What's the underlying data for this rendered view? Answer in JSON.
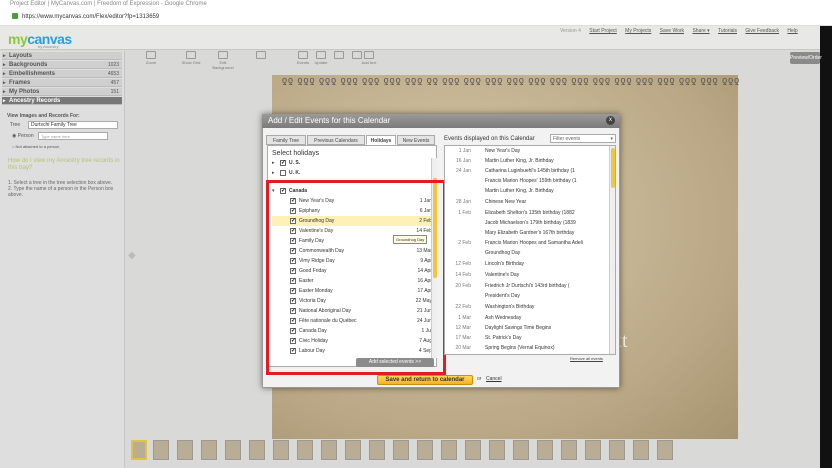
{
  "browser": {
    "title": "Project Editor | MyCanvas.com | Freedom of Expression - Google Chrome",
    "url": "https://www.mycanvas.com/Flex/editor?fp=1313659"
  },
  "app": {
    "logo_my": "my",
    "logo_canvas": "canvas",
    "logo_sub": "by Ancestry",
    "version": "Version 4",
    "links": [
      "Start Project",
      "My Projects",
      "Save Work",
      "Share ▾",
      "Tutorials",
      "Give Feedback",
      "Help"
    ],
    "preview": "Preview/Order"
  },
  "toolbar": [
    "Zoom",
    "Show Grid",
    "Edit Background",
    "",
    "Events",
    "Update",
    "",
    "",
    "Add text"
  ],
  "left_panel": {
    "sections": [
      {
        "label": "Layouts",
        "count": ""
      },
      {
        "label": "Backgrounds",
        "count": "1023"
      },
      {
        "label": "Embellishments",
        "count": "4653"
      },
      {
        "label": "Frames",
        "count": "457"
      },
      {
        "label": "My Photos",
        "count": "151"
      },
      {
        "label": "Ancestry Records",
        "count": ""
      }
    ],
    "view_label": "View Images and Records For:",
    "tree_label": "Tree",
    "tree_value": "Durtschi Family Tree",
    "person_label": "Person",
    "person_placeholder": "Type name here",
    "not_attached": "Not attached to a person",
    "help_link": "How do I view my Ancestry tree records in this tray?",
    "steps": "1. Select a tree in the tree selection box above.\n2. Type the name of a person in the Person box above."
  },
  "canvas": {
    "text": "xt"
  },
  "modal": {
    "title": "Add / Edit Events for this Calendar",
    "close": "x",
    "tabs": [
      "Family Tree",
      "Previous Calendars",
      "Holidays",
      "New Events"
    ],
    "select_label": "Select holidays",
    "countries": [
      {
        "name": "U. S.",
        "checked": true,
        "expanded": false
      },
      {
        "name": "U. K.",
        "checked": false,
        "expanded": false
      },
      {
        "name": "Canada",
        "checked": true,
        "expanded": true
      }
    ],
    "holidays": [
      {
        "name": "New Year's Day",
        "date": "1 Jan"
      },
      {
        "name": "Epiphany",
        "date": "6 Jan"
      },
      {
        "name": "Groundhog Day",
        "date": "2 Feb"
      },
      {
        "name": "Valentine's Day",
        "date": "14 Feb"
      },
      {
        "name": "Family Day",
        "date": ""
      },
      {
        "name": "Commonwealth Day",
        "date": "13 Mar"
      },
      {
        "name": "Vimy Ridge Day",
        "date": "9 Apr"
      },
      {
        "name": "Good Friday",
        "date": "14 Apr"
      },
      {
        "name": "Easter",
        "date": "16 Apr"
      },
      {
        "name": "Easter Monday",
        "date": "17 Apr"
      },
      {
        "name": "Victoria Day",
        "date": "22 May"
      },
      {
        "name": "National Aboriginal Day",
        "date": "21 Jun"
      },
      {
        "name": "Fête nationale du Québec",
        "date": "24 Jun"
      },
      {
        "name": "Canada Day",
        "date": "1 Jul"
      },
      {
        "name": "Civic Holiday",
        "date": "7 Aug"
      },
      {
        "name": "Labour Day",
        "date": "4 Sep"
      }
    ],
    "tooltip": "Groundhog Day",
    "add_button": "Add selected events >>",
    "right_header": "Events displayed on this Calendar",
    "filter": "Filter events",
    "events": [
      {
        "date": "1 Jan",
        "name": "New Year's Day"
      },
      {
        "date": "16 Jan",
        "name": "Martin Luther King, Jr. Birthday"
      },
      {
        "date": "24 Jan",
        "name": "Catharina Luginbuehl's 145th birthday (1"
      },
      {
        "date": "",
        "name": "Francis Marion Hoopes' 159th birthday (1"
      },
      {
        "date": "",
        "name": "Martin Luther King, Jr. Birthday"
      },
      {
        "date": "28 Jan",
        "name": "Chinese New Year"
      },
      {
        "date": "1 Feb",
        "name": "Elizabeth Shelton's 135th birthday (1882"
      },
      {
        "date": "",
        "name": "Jacob Michaelson's 179th birthday (1839"
      },
      {
        "date": "",
        "name": "Mary Elizabeth Gardner's 167th birthday"
      },
      {
        "date": "2 Feb",
        "name": "Francis Marion Hoopes and Samantha Adeli"
      },
      {
        "date": "",
        "name": "Groundhog Day"
      },
      {
        "date": "12 Feb",
        "name": "Lincoln's Birthday"
      },
      {
        "date": "14 Feb",
        "name": "Valentine's Day"
      },
      {
        "date": "20 Feb",
        "name": "Friedrich Jr Durtschi's 143rd birthday ("
      },
      {
        "date": "",
        "name": "President's Day"
      },
      {
        "date": "22 Feb",
        "name": "Washington's Birthday"
      },
      {
        "date": "1 Mar",
        "name": "Ash Wednesday"
      },
      {
        "date": "12 Mar",
        "name": "Daylight Savings Time Begins"
      },
      {
        "date": "17 Mar",
        "name": "St. Patrick's Day"
      },
      {
        "date": "20 Mar",
        "name": "Spring Begins (Vernal Equinox)"
      }
    ],
    "remove_all": "Remove all events",
    "save_button": "Save and return to calendar",
    "or": "or",
    "cancel": "Cancel"
  },
  "colors": {
    "accent_yellow": "#f0c63c",
    "highlight_red": "#e31b23",
    "logo_blue": "#2aa0d8",
    "logo_green": "#8cc63f"
  }
}
